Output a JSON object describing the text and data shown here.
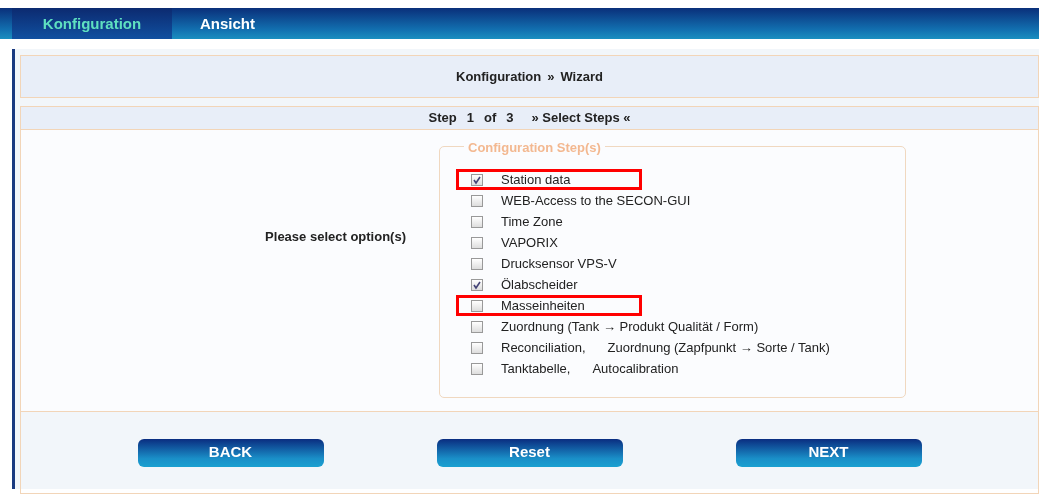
{
  "tabs": [
    {
      "label": "Konfiguration",
      "selected": true
    },
    {
      "label": "Ansicht",
      "selected": false
    }
  ],
  "breadcrumb": [
    "Konfiguration",
    "»",
    "Wizard"
  ],
  "step": {
    "word": "Step",
    "current": "1",
    "of": "of",
    "total": "3",
    "title": "» Select Steps «"
  },
  "prompt": "Please select option(s)",
  "fieldset": {
    "legend": "Configuration Step(s)",
    "options": [
      {
        "labels": [
          "Station data"
        ],
        "checked": true,
        "highlighted": true
      },
      {
        "labels": [
          "WEB-Access to the SECON-GUI"
        ],
        "checked": false,
        "highlighted": false
      },
      {
        "labels": [
          "Time Zone"
        ],
        "checked": false,
        "highlighted": false
      },
      {
        "labels": [
          "VAPORIX"
        ],
        "checked": false,
        "highlighted": false
      },
      {
        "labels": [
          "Drucksensor VPS-V"
        ],
        "checked": false,
        "highlighted": false
      },
      {
        "labels": [
          "Ölabscheider"
        ],
        "checked": true,
        "highlighted": false
      },
      {
        "labels": [
          "Masseinheiten"
        ],
        "checked": false,
        "highlighted": true
      },
      {
        "labels": [
          "Zuordnung (Tank → Produkt Qualität / Form)"
        ],
        "checked": false,
        "highlighted": false
      },
      {
        "labels": [
          "Reconciliation,",
          "Zuordnung (Zapfpunkt → Sorte / Tank)"
        ],
        "checked": false,
        "highlighted": false
      },
      {
        "labels": [
          "Tanktabelle,",
          "Autocalibration"
        ],
        "checked": false,
        "highlighted": false
      }
    ]
  },
  "buttons": [
    "BACK",
    "Reset",
    "NEXT"
  ]
}
